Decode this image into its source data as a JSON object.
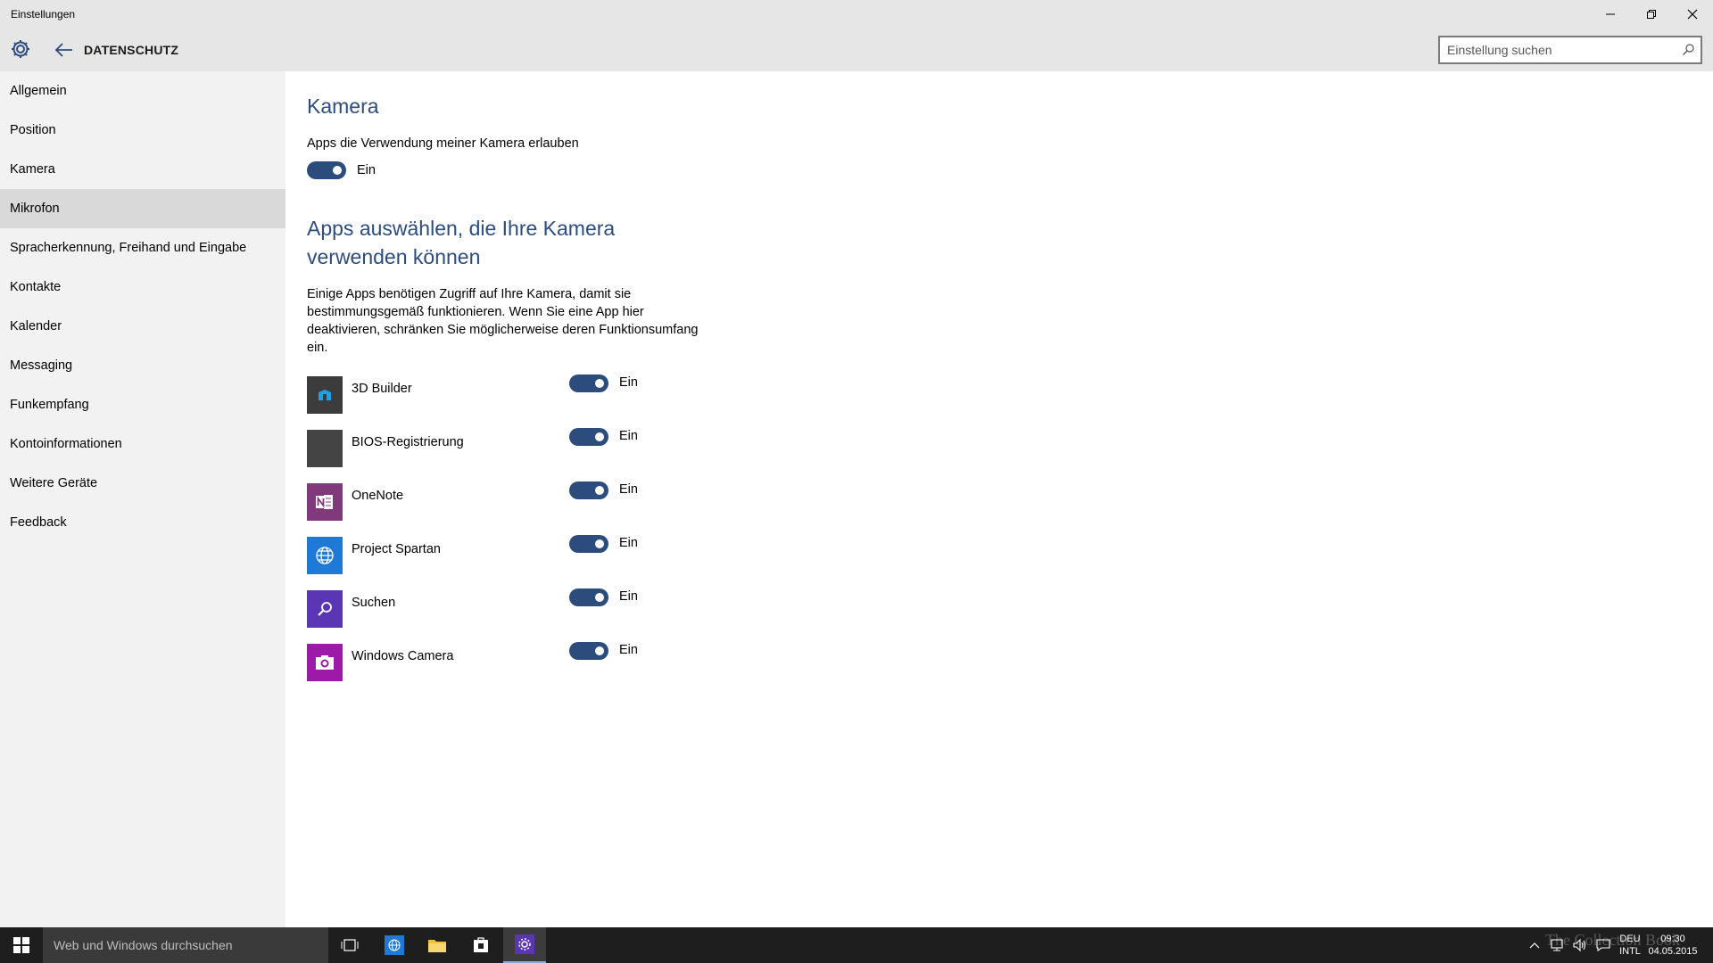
{
  "window": {
    "title": "Einstellungen"
  },
  "header": {
    "section_title": "DATENSCHUTZ",
    "search_placeholder": "Einstellung suchen"
  },
  "sidebar": {
    "items": [
      {
        "label": "Allgemein"
      },
      {
        "label": "Position"
      },
      {
        "label": "Kamera"
      },
      {
        "label": "Mikrofon"
      },
      {
        "label": "Spracherkennung, Freihand und Eingabe"
      },
      {
        "label": "Kontakte"
      },
      {
        "label": "Kalender"
      },
      {
        "label": "Messaging"
      },
      {
        "label": "Funkempfang"
      },
      {
        "label": "Kontoinformationen"
      },
      {
        "label": "Weitere Geräte"
      },
      {
        "label": "Feedback"
      }
    ],
    "active_item": "Mikrofon"
  },
  "main": {
    "heading": "Kamera",
    "allow_label": "Apps die Verwendung meiner Kamera erlauben",
    "allow_toggle_state": "Ein",
    "apps_heading": "Apps auswählen, die Ihre Kamera verwenden können",
    "apps_description": "Einige Apps benötigen Zugriff auf Ihre Kamera, damit sie bestimmungsgemäß funktionieren. Wenn Sie eine App hier deaktivieren, schränken Sie möglicherweise deren Funktionsumfang ein.",
    "accent_color": "#2c4c7e",
    "apps": [
      {
        "name": "3D Builder",
        "state": "Ein",
        "icon": "3d-builder-icon",
        "color": "#3c3c3c"
      },
      {
        "name": "BIOS-Registrierung",
        "state": "Ein",
        "icon": "bios-registration-icon",
        "color": "#444444"
      },
      {
        "name": "OneNote",
        "state": "Ein",
        "icon": "onenote-icon",
        "color": "#80397b"
      },
      {
        "name": "Project Spartan",
        "state": "Ein",
        "icon": "globe-icon",
        "color": "#1e7ad6"
      },
      {
        "name": "Suchen",
        "state": "Ein",
        "icon": "search-icon",
        "color": "#5a36b5"
      },
      {
        "name": "Windows Camera",
        "state": "Ein",
        "icon": "camera-icon",
        "color": "#9d1aa8"
      }
    ]
  },
  "taskbar": {
    "search_placeholder": "Web und Windows durchsuchen",
    "language_line1": "DEU",
    "language_line2": "INTL",
    "time": "09:30",
    "date": "04.05.2015",
    "watermark": "The Collection Book"
  }
}
